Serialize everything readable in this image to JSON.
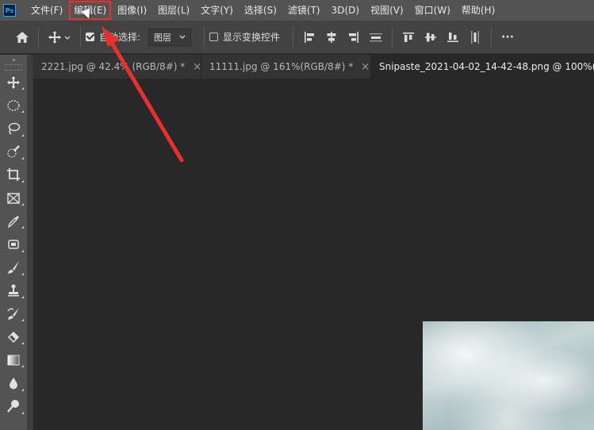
{
  "app": {
    "logo": "Ps"
  },
  "menu": {
    "items": [
      {
        "label": "文件(F)"
      },
      {
        "label": "编辑(E)",
        "highlighted": true
      },
      {
        "label": "图像(I)"
      },
      {
        "label": "图层(L)"
      },
      {
        "label": "文字(Y)"
      },
      {
        "label": "选择(S)"
      },
      {
        "label": "滤镜(T)"
      },
      {
        "label": "3D(D)"
      },
      {
        "label": "视图(V)"
      },
      {
        "label": "窗口(W)"
      },
      {
        "label": "帮助(H)"
      }
    ]
  },
  "options": {
    "auto_select_label": "自动选择:",
    "auto_select_checked": true,
    "auto_select_target": "图层",
    "show_transform_label": "显示变换控件",
    "show_transform_checked": false,
    "more_icon": "···"
  },
  "tabs": [
    {
      "label": "2221.jpg @ 42.4% (RGB/8#) *",
      "close": "×"
    },
    {
      "label": "11111.jpg @ 161%(RGB/8#) *",
      "close": "×"
    },
    {
      "label": "Snipaste_2021-04-02_14-42-48.png @ 100%(",
      "active": true
    }
  ],
  "toolbar": {
    "collapse_glyph": "»",
    "tools": [
      "move-tool",
      "marquee-tool",
      "lasso-tool",
      "quick-select-tool",
      "crop-tool",
      "frame-tool",
      "eyedropper-tool",
      "healing-tool",
      "brush-tool",
      "stamp-tool",
      "history-brush-tool",
      "eraser-tool",
      "gradient-tool",
      "blur-tool",
      "dodge-tool"
    ]
  },
  "annotation": {
    "arrow_color": "#e8302f",
    "highlight_color": "#e8302f"
  }
}
